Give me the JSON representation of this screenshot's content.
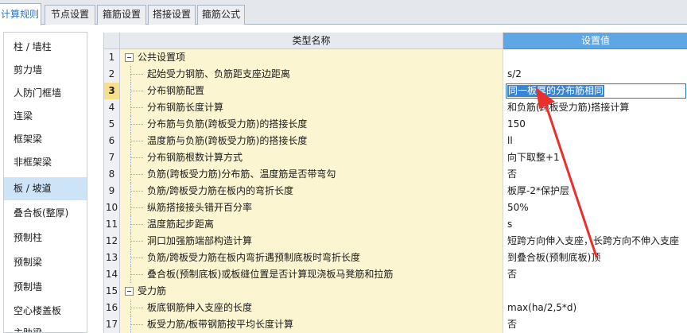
{
  "tabs": [
    {
      "label": "计算规则"
    },
    {
      "label": "节点设置"
    },
    {
      "label": "箍筋设置"
    },
    {
      "label": "搭接设置"
    },
    {
      "label": "箍筋公式"
    }
  ],
  "sidebar": {
    "items": [
      {
        "label": "柱 / 墙柱"
      },
      {
        "label": "剪力墙"
      },
      {
        "label": "人防门框墙"
      },
      {
        "label": "连梁"
      },
      {
        "label": "框架梁"
      },
      {
        "label": "非框架梁"
      },
      {
        "label": "板 / 坡道"
      },
      {
        "label": "叠合板(整厚)"
      },
      {
        "label": "预制柱"
      },
      {
        "label": "预制梁"
      },
      {
        "label": "预制墙"
      },
      {
        "label": "空心楼盖板"
      },
      {
        "label": "主肋梁"
      }
    ],
    "selected_index": 6
  },
  "table": {
    "col_name": "类型名称",
    "col_value": "设置值",
    "rows": [
      {
        "no": "1",
        "name": "公共设置项",
        "value": ""
      },
      {
        "no": "2",
        "name": "起始受力钢筋、负筋距支座边距离",
        "value": "s/2"
      },
      {
        "no": "3",
        "name": "分布钢筋配置",
        "value": "同一板厚的分布筋相同"
      },
      {
        "no": "4",
        "name": "分布钢筋长度计算",
        "value": "和负筋(跨板受力筋)搭接计算"
      },
      {
        "no": "5",
        "name": "分布筋与负筋(跨板受力筋)的搭接长度",
        "value": "150"
      },
      {
        "no": "6",
        "name": "温度筋与负筋(跨板受力筋)的搭接长度",
        "value": "ll"
      },
      {
        "no": "7",
        "name": "分布钢筋根数计算方式",
        "value": "向下取整+1"
      },
      {
        "no": "8",
        "name": "负筋(跨板受力筋)分布筋、温度筋是否带弯勾",
        "value": "否"
      },
      {
        "no": "9",
        "name": "负筋/跨板受力筋在板内的弯折长度",
        "value": "板厚-2*保护层"
      },
      {
        "no": "10",
        "name": "纵筋搭接接头错开百分率",
        "value": "50%"
      },
      {
        "no": "11",
        "name": "温度筋起步距离",
        "value": "s"
      },
      {
        "no": "12",
        "name": "洞口加强筋端部构造计算",
        "value": "短跨方向伸入支座，长跨方向不伸入支座"
      },
      {
        "no": "13",
        "name": "负筋/跨板受力筋在板内弯折遇预制底板时弯折长度",
        "value": "到叠合板(预制底板)顶"
      },
      {
        "no": "14",
        "name": "叠合板(预制底板)或板缝位置是否计算现浇板马凳筋和拉筋",
        "value": "否"
      },
      {
        "no": "15",
        "name": "受力筋",
        "value": ""
      },
      {
        "no": "16",
        "name": "板底钢筋伸入支座的长度",
        "value": "max(ha/2,5*d)"
      },
      {
        "no": "17",
        "name": "板受力筋/板带钢筋按平均长度计算",
        "value": "否"
      }
    ],
    "selected_row": 3
  },
  "colors": {
    "header_accent": "#5fa6e4",
    "name_cell_bg": "#fbf5d2",
    "selected_nav": "#cde3f7",
    "annotation_arrow": "#e8302c"
  }
}
